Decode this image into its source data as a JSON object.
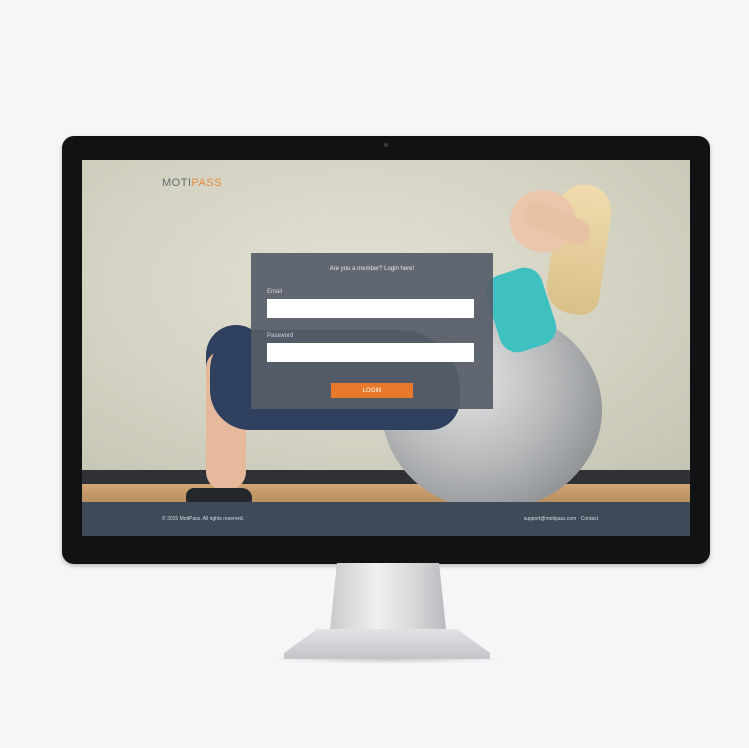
{
  "site": {
    "brand_part1": "MOTI",
    "brand_part2": "PASS"
  },
  "login": {
    "title": "Are you a member? Login here!",
    "email_label": "Email",
    "email_value": "",
    "password_label": "Password",
    "password_value": "",
    "submit_label": "LOGIN"
  },
  "footer": {
    "left_text": "© 2015 MotiPass. All rights reserved.",
    "right_text": "support@motipass.com  ·  Contact"
  },
  "colors": {
    "accent": "#e8792b",
    "panel": "#565e68",
    "footer": "#3f4a59"
  }
}
